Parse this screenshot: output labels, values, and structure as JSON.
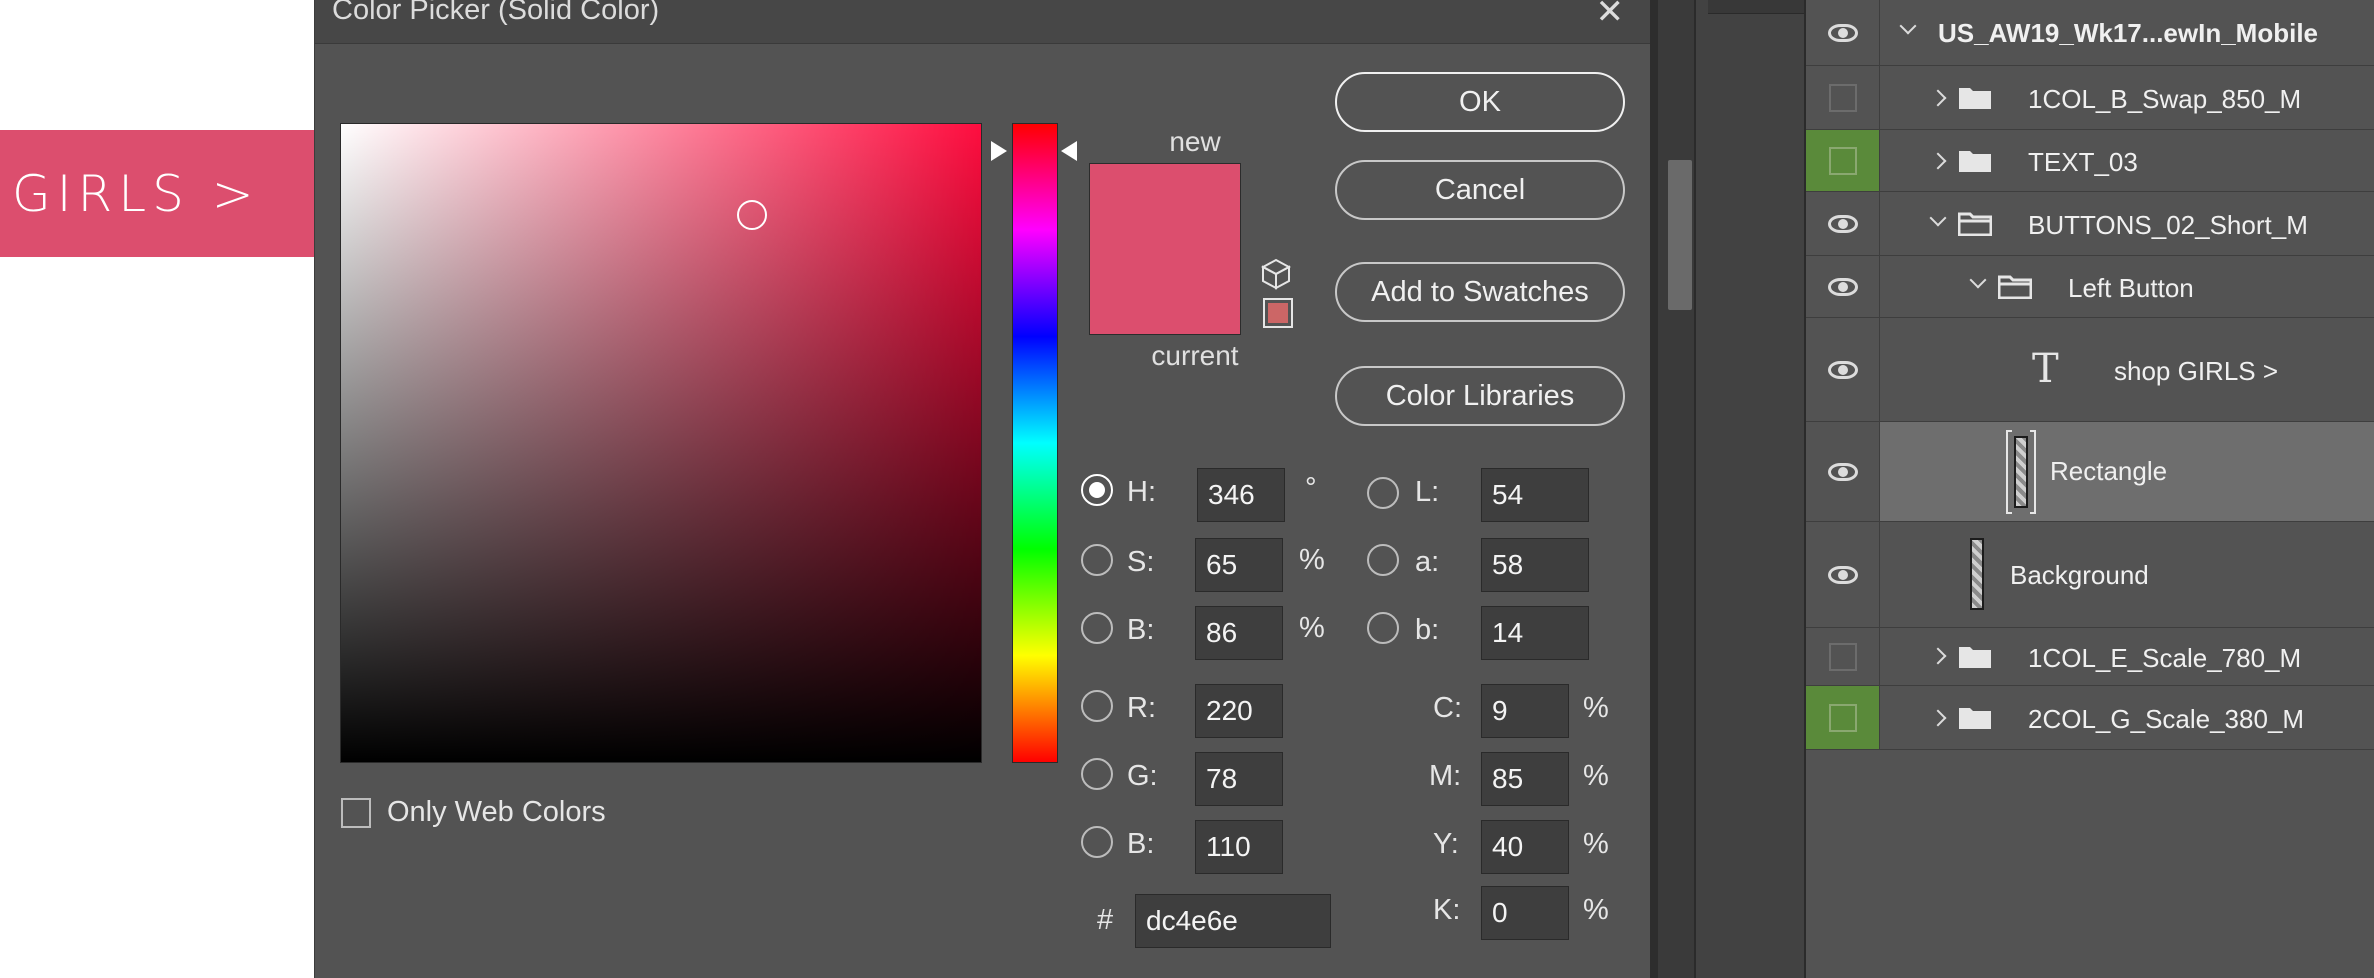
{
  "canvas": {
    "banner_text": "GIRLS >",
    "banner_color": "#dc4e6e"
  },
  "dialog": {
    "title": "Color Picker (Solid Color)",
    "close_icon": "close-icon",
    "new_label": "new",
    "current_label": "current",
    "new_color": "#dc4e6e",
    "current_color": "#dc4e6e",
    "websafe_color": "#cc6666",
    "buttons": {
      "ok": "OK",
      "cancel": "Cancel",
      "add_to_swatches": "Add to Swatches",
      "color_libraries": "Color Libraries"
    },
    "fields": {
      "H": {
        "label": "H:",
        "value": "346",
        "unit": "°"
      },
      "S": {
        "label": "S:",
        "value": "65",
        "unit": "%"
      },
      "Bv": {
        "label": "B:",
        "value": "86",
        "unit": "%"
      },
      "R": {
        "label": "R:",
        "value": "220"
      },
      "G": {
        "label": "G:",
        "value": "78"
      },
      "Bc": {
        "label": "B:",
        "value": "110"
      },
      "L": {
        "label": "L:",
        "value": "54"
      },
      "a": {
        "label": "a:",
        "value": "58"
      },
      "b": {
        "label": "b:",
        "value": "14"
      },
      "C": {
        "label": "C:",
        "value": "9",
        "unit": "%"
      },
      "M": {
        "label": "M:",
        "value": "85",
        "unit": "%"
      },
      "Y": {
        "label": "Y:",
        "value": "40",
        "unit": "%"
      },
      "K": {
        "label": "K:",
        "value": "0",
        "unit": "%"
      }
    },
    "hex_label": "#",
    "hex_value": "dc4e6e",
    "only_web_colors": "Only Web Colors",
    "selected_mode": "H"
  },
  "layers": [
    {
      "name": "US_AW19_Wk17...ewIn_Mobile",
      "visible": true,
      "expanded": true,
      "kind": "group"
    },
    {
      "name": "1COL_B_Swap_850_M",
      "visible": false,
      "expanded": false,
      "kind": "group"
    },
    {
      "name": "TEXT_03",
      "visible": false,
      "expanded": false,
      "kind": "group"
    },
    {
      "name": "BUTTONS_02_Short_M",
      "visible": true,
      "expanded": true,
      "kind": "group"
    },
    {
      "name": "Left Button",
      "visible": true,
      "expanded": true,
      "kind": "group"
    },
    {
      "name": "shop GIRLS >",
      "visible": true,
      "kind": "text"
    },
    {
      "name": "Rectangle",
      "visible": true,
      "kind": "shape",
      "selected": true
    },
    {
      "name": "Background",
      "visible": true,
      "kind": "shape"
    },
    {
      "name": "1COL_E_Scale_780_M",
      "visible": false,
      "expanded": false,
      "kind": "group"
    },
    {
      "name": "2COL_G_Scale_380_M",
      "visible": false,
      "expanded": false,
      "kind": "group"
    }
  ]
}
